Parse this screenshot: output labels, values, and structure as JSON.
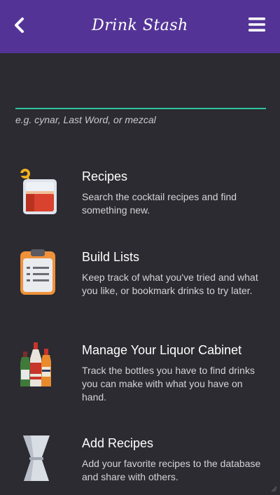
{
  "header": {
    "title": "Drink Stash",
    "back_icon": "chevron-left-icon",
    "menu_icon": "hamburger-menu-icon"
  },
  "search": {
    "value": "",
    "hint": "e.g. cynar, Last Word, or mezcal"
  },
  "features": [
    {
      "icon": "cocktail-glass-icon",
      "title": "Recipes",
      "description": "Search the cocktail recipes and find something new."
    },
    {
      "icon": "clipboard-list-icon",
      "title": "Build Lists",
      "description": "Keep track of what you've tried and what you like, or bookmark drinks to try later."
    },
    {
      "icon": "liquor-bottles-icon",
      "title": "Manage Your Liquor Cabinet",
      "description": "Track the bottles you have to find drinks you can make with what you have on hand."
    },
    {
      "icon": "jigger-icon",
      "title": "Add Recipes",
      "description": "Add your favorite recipes to the database and share with others."
    }
  ],
  "colors": {
    "header": "#533496",
    "background": "#2b2b31",
    "accent": "#2ec4a0"
  }
}
